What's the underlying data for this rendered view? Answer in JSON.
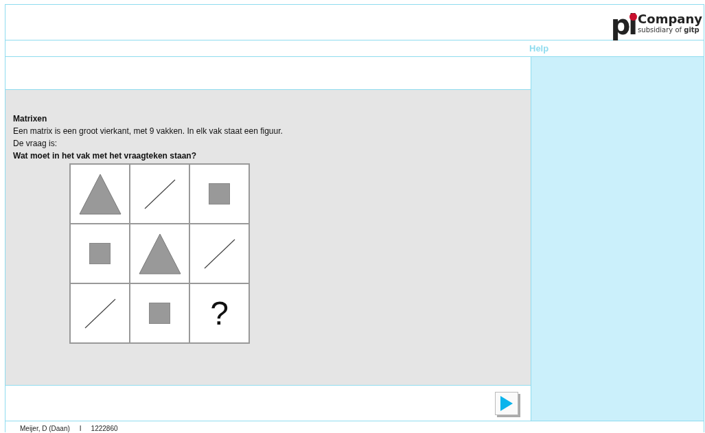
{
  "logo": {
    "mark": "pi",
    "name": "Company",
    "tagline_prefix": "subsidiary of",
    "tagline_brand": "gitp"
  },
  "help_link": "Help",
  "question": {
    "title": "Matrixen",
    "lines": [
      "Een matrix is een groot vierkant, met 9 vakken. In elk vak staat een figuur.",
      "De vraag is:"
    ],
    "prompt": "Wat moet in het vak met het vraagteken staan?"
  },
  "matrix": [
    {
      "kind": "triangle"
    },
    {
      "kind": "line"
    },
    {
      "kind": "square"
    },
    {
      "kind": "square"
    },
    {
      "kind": "triangle"
    },
    {
      "kind": "line"
    },
    {
      "kind": "line"
    },
    {
      "kind": "square"
    },
    {
      "kind": "question",
      "text": "?"
    }
  ],
  "footer": {
    "user": "Meijer, D (Daan)",
    "separator": "I",
    "id": "1222860"
  }
}
